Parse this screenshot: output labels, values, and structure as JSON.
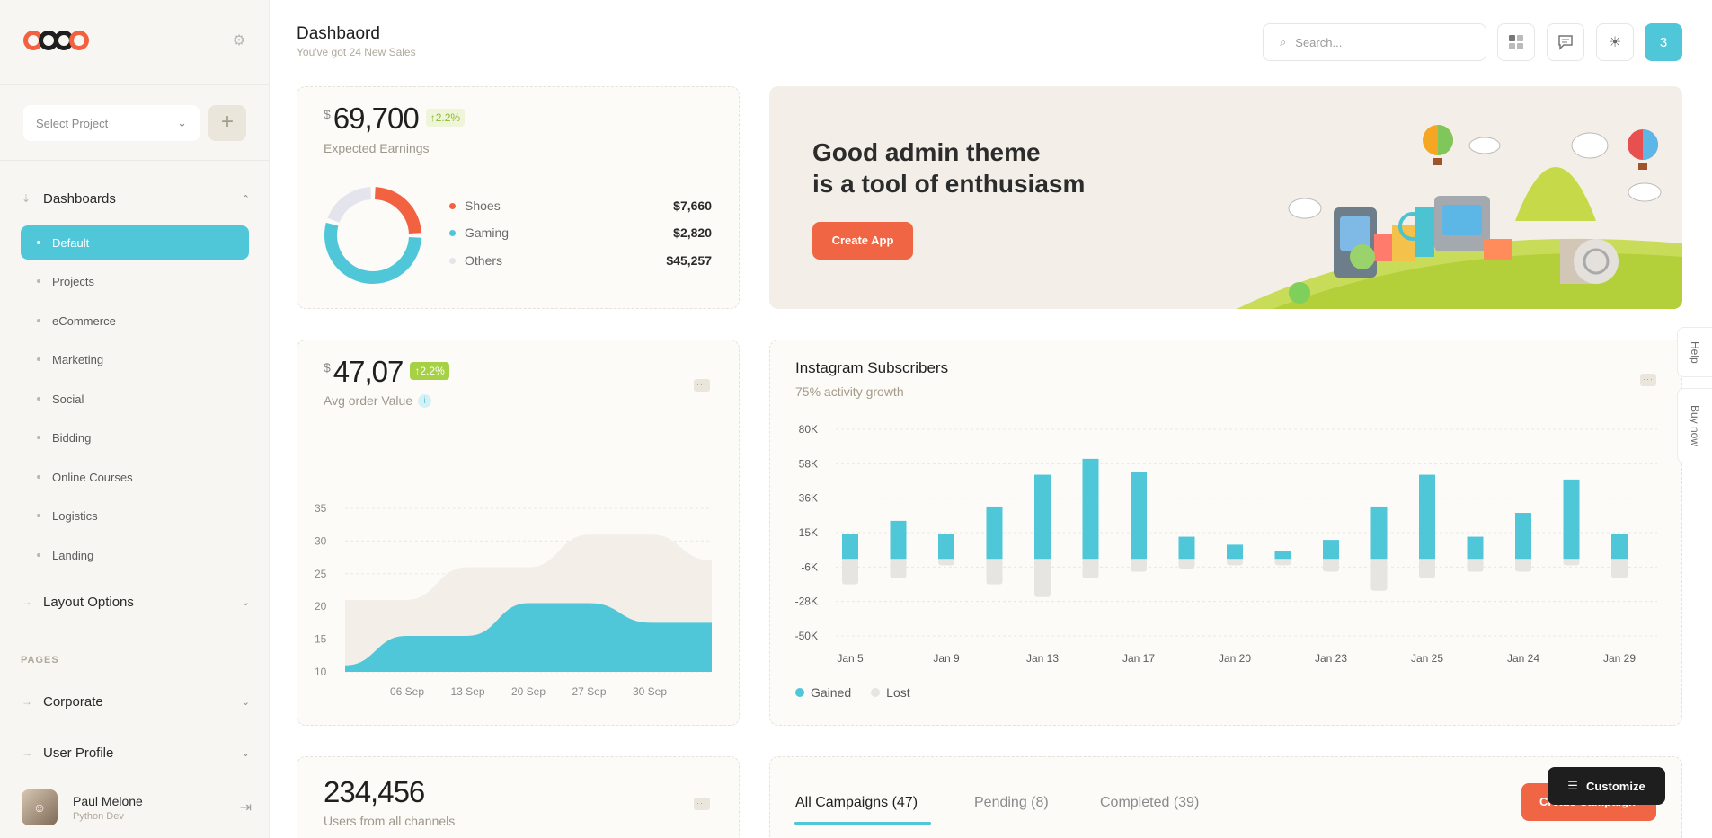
{
  "sidebar": {
    "select_project": "Select Project",
    "nav": {
      "dashboards": "Dashboards",
      "items": [
        "Default",
        "Projects",
        "eCommerce",
        "Marketing",
        "Social",
        "Bidding",
        "Online Courses",
        "Logistics",
        "Landing"
      ],
      "layout_options": "Layout Options",
      "pages_label": "PAGES",
      "corporate": "Corporate",
      "user_profile": "User Profile"
    },
    "profile": {
      "name": "Paul Melone",
      "role": "Python Dev"
    }
  },
  "header": {
    "title": "Dashbaord",
    "subtitle": "You've got 24 New Sales",
    "search_placeholder": "Search...",
    "notifications": "3"
  },
  "earnings": {
    "currency": "$",
    "amount": "69,700",
    "change": "↑2.2%",
    "label": "Expected Earnings",
    "donut": [
      {
        "name": "Shoes",
        "value": "$7,660",
        "color": "#f26241",
        "share": 0.25
      },
      {
        "name": "Gaming",
        "value": "$2,820",
        "color": "#4fc7d9",
        "share": 0.55
      },
      {
        "name": "Others",
        "value": "$45,257",
        "color": "#e4e4ec",
        "share": 0.2
      }
    ]
  },
  "hero": {
    "line1": "Good admin theme",
    "line2": "is a tool of enthusiasm",
    "button": "Create App"
  },
  "avg_order": {
    "currency": "$",
    "amount": "47,07",
    "change": "↑2.2%",
    "label": "Avg order Value",
    "info": "i",
    "chart": {
      "type": "area",
      "y_ticks": [
        "35",
        "30",
        "25",
        "20",
        "15",
        "10"
      ],
      "x_labels": [
        "06 Sep",
        "13 Sep",
        "20 Sep",
        "27 Sep",
        "30 Sep"
      ]
    }
  },
  "instagram": {
    "title": "Instagram Subscribers",
    "subtitle": "75% activity growth",
    "y_ticks": [
      "80K",
      "58K",
      "36K",
      "15K",
      "-6K",
      "-28K",
      "-50K"
    ],
    "x_labels": [
      "Jan 5",
      "Jan 9",
      "Jan 13",
      "Jan 17",
      "Jan 20",
      "Jan 23",
      "Jan 25",
      "Jan 24",
      "Jan 29"
    ],
    "legend": {
      "gained": "Gained",
      "lost": "Lost"
    },
    "colors": {
      "gained": "#4fc7d9",
      "lost": "#e7e5e2"
    }
  },
  "chart_data": [
    {
      "type": "area",
      "ylim": [
        10,
        35
      ],
      "x": [
        "06 Sep",
        "13 Sep",
        "20 Sep",
        "27 Sep",
        "30 Sep"
      ],
      "series": [
        {
          "values": [
            21,
            21,
            26,
            26,
            31,
            31,
            27
          ]
        },
        {
          "values": [
            11,
            15.5,
            15.5,
            20.5,
            20.5,
            17.5,
            17.5
          ]
        }
      ]
    },
    {
      "type": "bar",
      "ylim": [
        -50,
        80
      ],
      "categories": [
        "",
        "Jan 5",
        "",
        "Jan 9",
        "",
        "Jan 13",
        "",
        "Jan 17",
        "",
        "Jan 20",
        "",
        "Jan 23",
        "",
        "Jan 25",
        "",
        "Jan 24",
        "",
        "Jan 29"
      ],
      "series": [
        {
          "name": "Gained",
          "values": [
            16,
            24,
            16,
            33,
            53,
            63,
            55,
            14,
            9,
            5,
            12,
            33,
            53,
            14,
            29,
            50,
            16
          ]
        },
        {
          "name": "Lost",
          "values": [
            -16,
            -12,
            -4,
            -16,
            -24,
            -12,
            -8,
            -6,
            -4,
            -4,
            -8,
            -20,
            -12,
            -8,
            -8,
            -4,
            -12
          ]
        }
      ]
    }
  ],
  "users": {
    "amount": "234,456",
    "label": "Users from all channels"
  },
  "campaigns": {
    "tabs": [
      "All Campaigns (47)",
      "Pending (8)",
      "Completed (39)"
    ],
    "create_button": "Create Campaign"
  },
  "floating": {
    "customize": "Customize",
    "help": "Help",
    "buy_now": "Buy now"
  }
}
